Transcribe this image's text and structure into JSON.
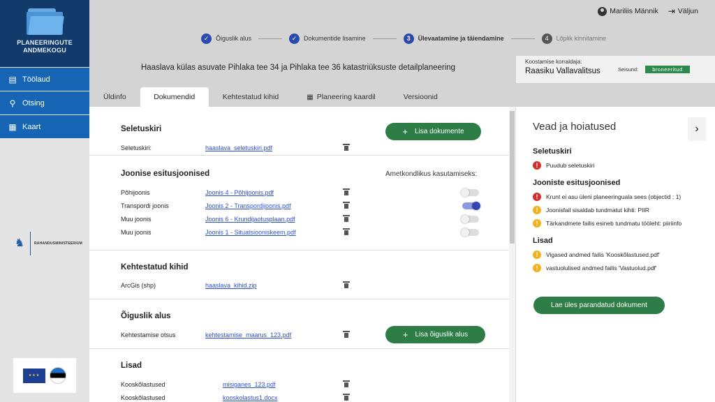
{
  "sidebar": {
    "title_line1": "PLANEERINGUTE",
    "title_line2": "ANDMEKOGU",
    "items": [
      {
        "label": "Töölaud",
        "icon": "clipboard-icon"
      },
      {
        "label": "Otsing",
        "icon": "search-icon"
      },
      {
        "label": "Kaart",
        "icon": "map-icon"
      }
    ],
    "ministry": "RAHANDUSMINISTEERIUM"
  },
  "header": {
    "user": "Mariliis Männik",
    "logout": "Väljun",
    "steps": [
      {
        "num": "✓",
        "label": "Õiguslik alus",
        "state": "done"
      },
      {
        "num": "✓",
        "label": "Dokumentide lisamine",
        "state": "done"
      },
      {
        "num": "3",
        "label": "Ülevaatamine ja täiendamine",
        "state": "current"
      },
      {
        "num": "4",
        "label": "Lõplik kinnitamine",
        "state": "todo"
      }
    ],
    "plan_title": "Haaslava külas asuvate Pihlaka tee 34 ja Pihlaka tee 36 katastriüksuste detailplaneering",
    "organizer_label": "Koostamise korraldaja:",
    "organizer": "Raasiku Vallavalitsus",
    "status_label": "Seisund:",
    "status": "broneeritud"
  },
  "tabs": [
    "Üldinfo",
    "Dokumendid",
    "Kehtestatud kihid",
    "Planeering kaardil",
    "Versioonid"
  ],
  "documents": {
    "seletuskiri": {
      "title": "Seletuskiri",
      "add_button": "Lisa dokumente",
      "row_label": "Seletuskiri:",
      "file": "haaslava_seletuskiri.pdf"
    },
    "joonised": {
      "title": "Joonise esitusjoonised",
      "official_use": "Ametkondlikus kasutamiseks:",
      "rows": [
        {
          "label": "Põhijoonis",
          "file": "Joonis 4 - Põhijoonis.pdf",
          "on": false
        },
        {
          "label": "Transpordi joonis",
          "file": "Joonis 2 - Transpordijoonis.pdf",
          "on": true
        },
        {
          "label": "Muu joonis",
          "file": "Joonis 6 - Krundijaotusplaan.pdf",
          "on": false
        },
        {
          "label": "Muu joonis",
          "file": "Joonis 1 - Situatsiooniskeem.pdf",
          "on": false
        }
      ]
    },
    "kihid": {
      "title": "Kehtestatud kihid",
      "row_label": "ArcGis (shp)",
      "file": "haaslava_kihid.zip"
    },
    "alus": {
      "title": "Õiguslik alus",
      "row_label": "Kehtestamise otsus",
      "file": "kehtestamise_maarus_123.pdf",
      "add_button": "Lisa õiguslik alus"
    },
    "lisad": {
      "title": "Lisad",
      "rows": [
        {
          "label": "Kooskõlastused",
          "file": "misiganes_123.pdf"
        },
        {
          "label": "Kooskõlastused",
          "file": "kooskolastus1.docx"
        }
      ]
    }
  },
  "errors_panel": {
    "title": "Vead ja hoiatused",
    "groups": [
      {
        "title": "Seletuskiri",
        "items": [
          {
            "type": "err",
            "text": "Puudub seletuskiri"
          }
        ]
      },
      {
        "title": "Jooniste esitusjoonised",
        "items": [
          {
            "type": "err",
            "text": "Krunt ei asu üleni planeeringuala sees (objectid : 1)"
          },
          {
            "type": "warn",
            "text": "Joonisfail sisaldab tundmatut kihti: PIIR"
          },
          {
            "type": "warn",
            "text": "Tärkandmete failis esineb tundmatu tööleht: piiriinfo"
          }
        ]
      },
      {
        "title": "Lisad",
        "items": [
          {
            "type": "warn",
            "text": "Vigased andmed failis 'Kooskõlastused.pdf'"
          },
          {
            "type": "warn",
            "text": "vastuolulised andmed failis 'Vastuolud.pdf'"
          }
        ]
      }
    ],
    "upload_button": "Lae üles parandatud dokument"
  }
}
